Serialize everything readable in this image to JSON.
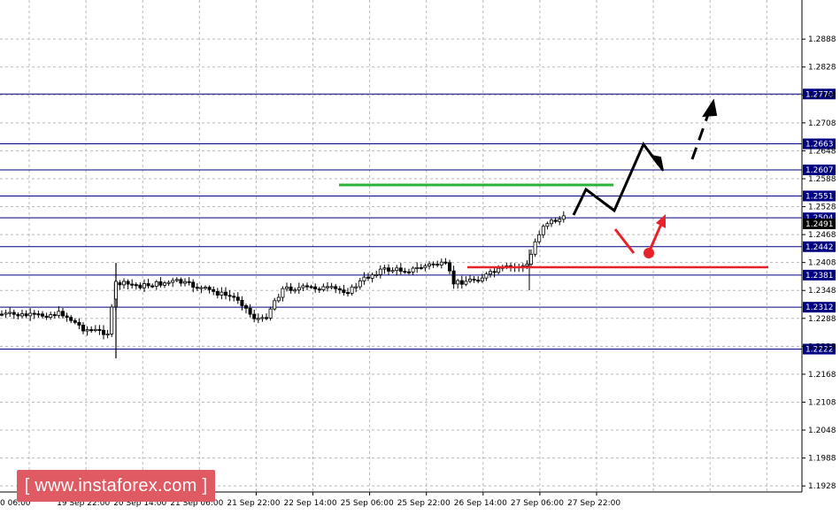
{
  "chart_data": {
    "type": "candlestick",
    "ylim": [
      1.1915,
      1.2972
    ],
    "grid": true,
    "y_ticks": [
      "1.2888",
      "1.2828",
      "1.2768",
      "1.2708",
      "1.2648",
      "1.2588",
      "1.2528",
      "1.2468",
      "1.2408",
      "1.2348",
      "1.2288",
      "1.2228",
      "1.2168",
      "1.2108",
      "1.2048",
      "1.1988",
      "1.1928"
    ],
    "x_ticks": [
      "0 06:00",
      "19 Sep 22:00",
      "20 Sep 14:00",
      "21 Sep 06:00",
      "21 Sep 22:00",
      "22 Sep 14:00",
      "25 Sep 06:00",
      "25 Sep 22:00",
      "26 Sep 14:00",
      "27 Sep 06:00",
      "27 Sep 22:00"
    ],
    "levels": [
      {
        "label": "1.2770",
        "value": 1.277
      },
      {
        "label": "1.2663",
        "value": 1.2663
      },
      {
        "label": "1.2607",
        "value": 1.2607
      },
      {
        "label": "1.2551",
        "value": 1.2551
      },
      {
        "label": "1.2504",
        "value": 1.2504
      },
      {
        "label": "1.2442",
        "value": 1.2442
      },
      {
        "label": "1.2381",
        "value": 1.2381
      },
      {
        "label": "1.2312",
        "value": 1.2312
      },
      {
        "label": "1.2222",
        "value": 1.2222
      }
    ],
    "current_price": "1.2491",
    "colors": {
      "level": "#000080",
      "support": "#e8222a",
      "resistance": "#2db23a",
      "forecast": "#000000",
      "forecast_alt": "#e8222a",
      "logo": "#e05a63"
    }
  },
  "watermark": {
    "text": "[ www.instaforex.com ]"
  }
}
